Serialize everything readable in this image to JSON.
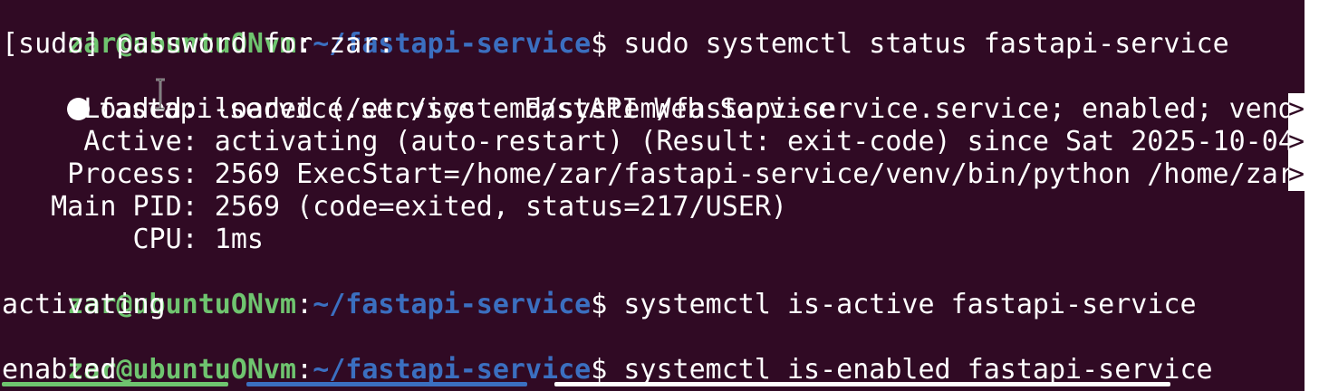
{
  "prompt": {
    "user_host": "zar@ubuntuONvm",
    "colon": ":",
    "path": "~/fastapi-service",
    "dollar": "$"
  },
  "lines": {
    "cmd1": " sudo systemctl status fastapi-service",
    "sudo_prompt": "[sudo] password for zar:",
    "unit_header": "fastapi-service.service - FastAPI Web Service",
    "loaded": "     Loaded: loaded (/etc/systemd/system/fastapi-service.service; enabled; vend",
    "active": "     Active: activating (auto-restart) (Result: exit-code) since Sat 2025-10-04",
    "process": "    Process: 2569 ExecStart=/home/zar/fastapi-service/venv/bin/python /home/zar",
    "main_pid": "   Main PID: 2569 (code=exited, status=217/USER)",
    "cpu": "        CPU: 1ms",
    "cmd2": " systemctl is-active fastapi-service",
    "out2": "activating",
    "cmd3": " systemctl is-enabled fastapi-service",
    "out3": "enabled"
  },
  "truncation_marker": ">",
  "colors": {
    "background": "#300a24",
    "user_host": "#6fc46f",
    "path": "#3b6fc0",
    "text": "#ffffff"
  },
  "icons": {
    "status_dot": "status-dot-icon",
    "mouse_cursor": "ibeam-cursor-icon"
  }
}
